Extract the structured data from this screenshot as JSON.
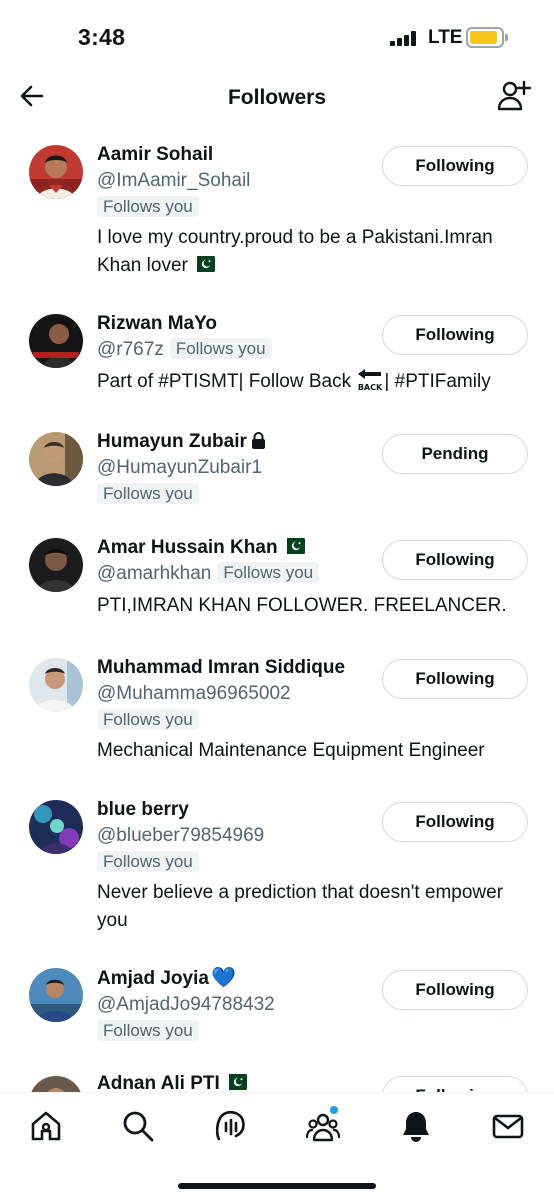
{
  "status_bar": {
    "time": "3:48",
    "network": "LTE",
    "battery_color": "#f5c518"
  },
  "header": {
    "title": "Followers",
    "back_icon": "arrow-left-icon",
    "action_icon": "add-user-icon"
  },
  "followers": [
    {
      "name": "Aamir Sohail",
      "handle": "@ImAamir_Sohail",
      "follows_you": "Follows you",
      "bio": "I love my country.proud to be a Pakistani.Imran Khan lover",
      "bio_flag": "pakistan-flag",
      "button": "Following"
    },
    {
      "name": "Rizwan MaYo",
      "handle": "@r767z",
      "follows_you": "Follows you",
      "bio_a": "Part of #PTISMT| Follow Back",
      "bio_b": "| #PTIFamily",
      "button": "Following"
    },
    {
      "name": "Humayun Zubair",
      "handle": "@HumayunZubair1",
      "follows_you": "Follows you",
      "button": "Pending",
      "protected_icon": "lock-icon"
    },
    {
      "name": "Amar Hussain Khan",
      "handle": "@amarhkhan",
      "follows_you": "Follows you",
      "bio": "PTI,IMRAN KHAN FOLLOWER. FREELANCER.",
      "button": "Following"
    },
    {
      "name": "Muhammad Imran Siddique",
      "handle": "@Muhamma96965002",
      "follows_you": "Follows you",
      "bio": "Mechanical Maintenance Equipment Engineer",
      "button": "Following"
    },
    {
      "name": "blue berry",
      "handle": "@blueber79854969",
      "follows_you": "Follows you",
      "bio": "Never believe a prediction that doesn't empower you",
      "button": "Following"
    },
    {
      "name": "Amjad Joyia",
      "name_emoji": "💙",
      "handle": "@AmjadJo94788432",
      "follows_you": "Follows you",
      "button": "Following"
    },
    {
      "name": "Adnan Ali PTI",
      "button": "Following"
    }
  ],
  "nav": {
    "items": [
      "home-icon",
      "search-icon",
      "spaces-icon",
      "communities-icon",
      "notifications-icon",
      "messages-icon"
    ],
    "accent": "#1d9bf0"
  }
}
